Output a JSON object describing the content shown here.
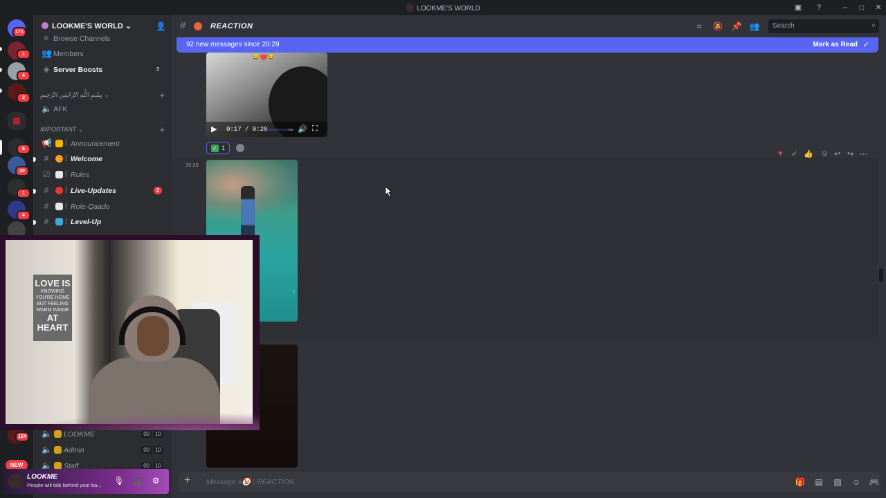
{
  "window": {
    "title": "LOOKME'S WORLD"
  },
  "rail": {
    "home_badge": "171",
    "servers": [
      {
        "badge": "1",
        "color": "#7a2430"
      },
      {
        "badge": "4",
        "color": "#9aa0a6"
      },
      {
        "badge": "2",
        "color": "#5a1a1a"
      },
      {
        "badge": "",
        "color": "#b0202a"
      },
      {
        "badge": "6",
        "color": "#2b2d31"
      },
      {
        "badge": "20",
        "color": "#3a5a9a"
      },
      {
        "badge": "1",
        "color": "#2e2e2e"
      },
      {
        "badge": "4",
        "color": "#2d3a8c"
      },
      {
        "badge": "",
        "color": "#444"
      }
    ],
    "lower_badge": "154",
    "new_label": "NEW"
  },
  "sidebar": {
    "server_name": "LOOKME'S WORLD",
    "browse_channels": "Browse Channels",
    "members": "Members",
    "server_boosts": "Server Boosts",
    "server_boosts_count": "3",
    "category_arabic": "بِسْمِ اللَّهِ الرَّحْمَنِ الرَّحِيمِ",
    "afk": "AFK",
    "category_important": "IMPORTANT",
    "channels": [
      {
        "label": "Announcement",
        "bright": false,
        "emoji_color": "#f4b400",
        "badge": ""
      },
      {
        "label": "Welcome",
        "bright": true,
        "emoji_color": "#ff9f1c",
        "badge": ""
      },
      {
        "label": "Rules",
        "bright": false,
        "emoji_color": "#e6e6e6",
        "badge": ""
      },
      {
        "label": "Live-Updates",
        "bright": true,
        "emoji_color": "#e53935",
        "badge": "2"
      },
      {
        "label": "Role-Qaado",
        "bright": false,
        "emoji_color": "#e6e6e6",
        "badge": ""
      },
      {
        "label": "Level-Up",
        "bright": true,
        "emoji_color": "#3fa7d6",
        "badge": ""
      }
    ],
    "voice_channels": [
      {
        "label": "LOOKME",
        "s1": "00",
        "s2": "10"
      },
      {
        "label": "Admin",
        "s1": "00",
        "s2": "10"
      },
      {
        "label": "Staff",
        "s1": "00",
        "s2": "10"
      }
    ]
  },
  "user_panel": {
    "username": "LOOKME",
    "status": "People will talk behind your ba..."
  },
  "channel": {
    "name": "REACTION",
    "search_placeholder": "Search"
  },
  "banner": {
    "text": "92 new messages since 20:29",
    "mark_read": "Mark as Read"
  },
  "video": {
    "time": "0:17 / 0:20",
    "progress": 0.85,
    "emojis": "😂❤️😂"
  },
  "reaction": {
    "count": "1"
  },
  "message": {
    "timestamp": "20:39"
  },
  "composer": {
    "placeholder": "Message #🤡 | REACTION"
  },
  "webcam": {
    "sign_big": "LOVE IS",
    "sign_small": "KNOWING YOU'RE HOME BUT FEELING WARM INSIDE",
    "sign_end": "AT HEART"
  }
}
